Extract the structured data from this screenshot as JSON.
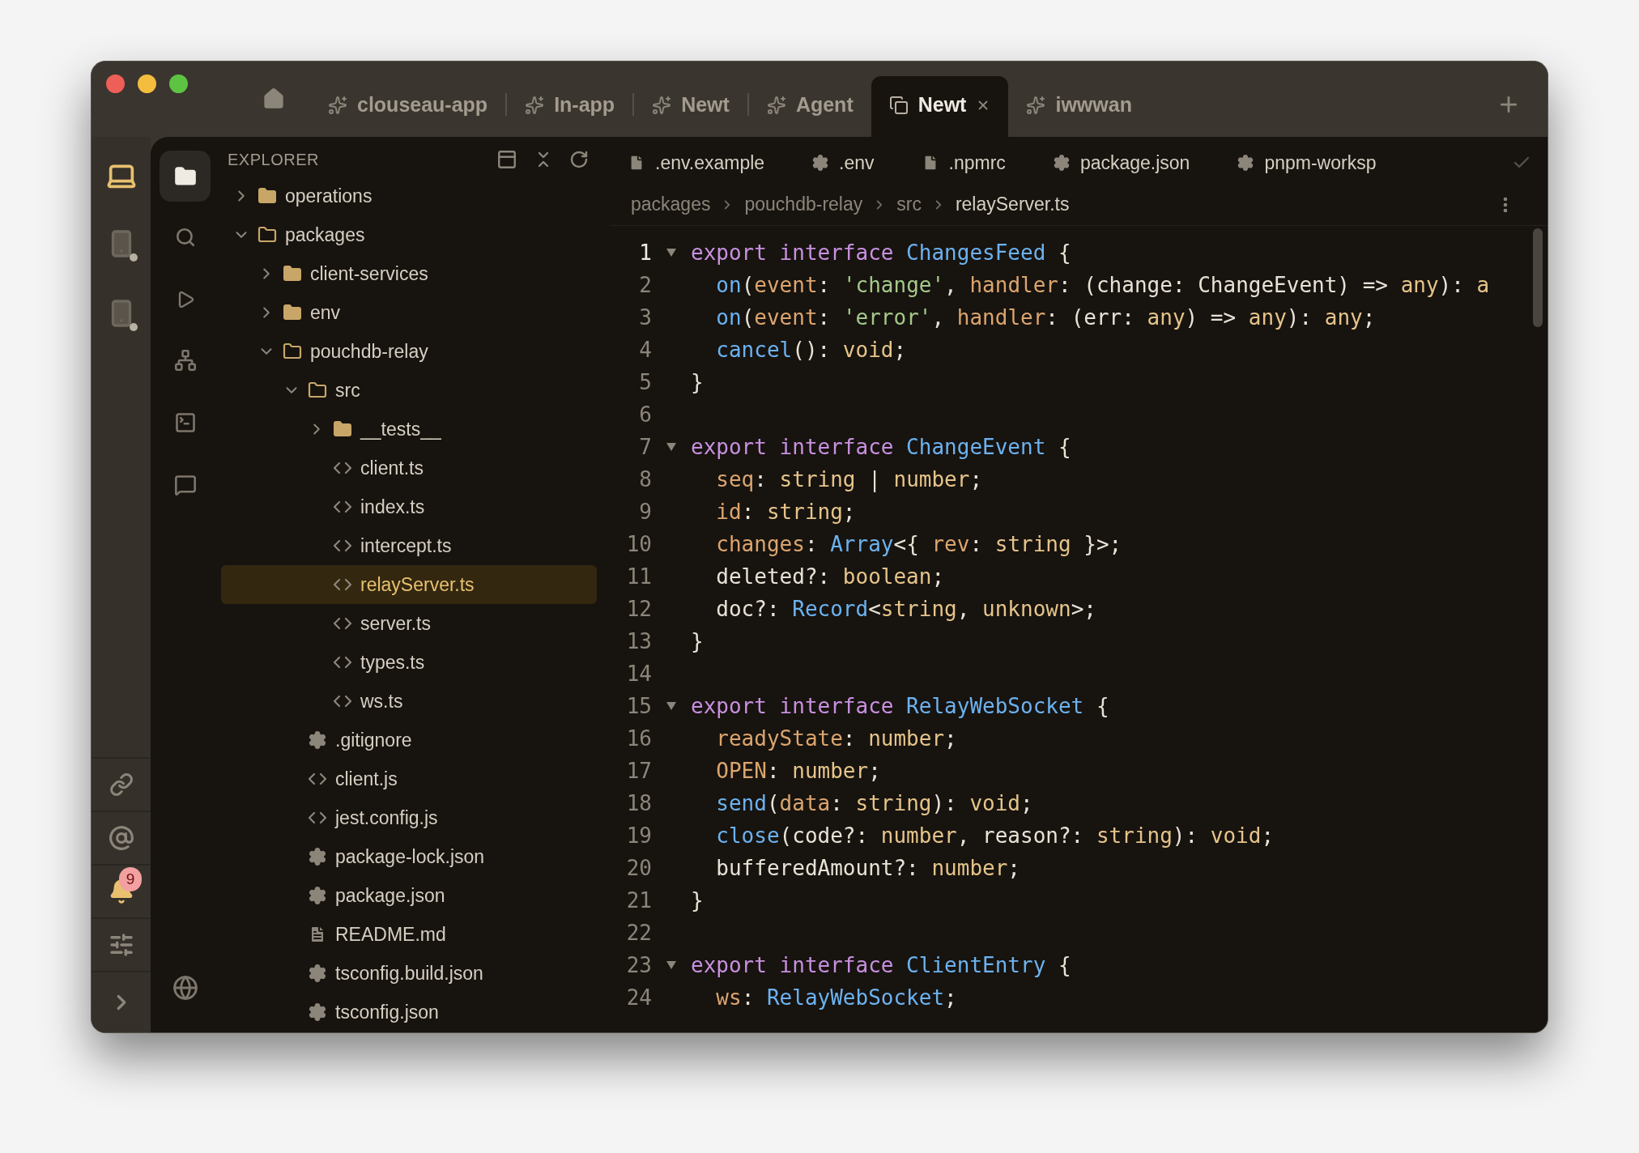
{
  "title_tabs": [
    {
      "label": "clouseau-app",
      "selected": false
    },
    {
      "label": "In-app",
      "selected": false
    },
    {
      "label": "Newt",
      "selected": false
    },
    {
      "label": "Agent",
      "selected": false
    },
    {
      "label": "Newt",
      "selected": true
    },
    {
      "label": "iwwwan",
      "selected": false
    }
  ],
  "device_rail": [
    {
      "selected": true
    },
    {
      "selected": false
    },
    {
      "selected": false
    }
  ],
  "notifications": {
    "count": "9"
  },
  "activity_bar": [
    {
      "selected": true
    },
    {
      "selected": false
    },
    {
      "selected": false
    },
    {
      "selected": false
    },
    {
      "selected": false
    },
    {
      "selected": false
    }
  ],
  "explorer": {
    "title": "EXPLORER",
    "tree": [
      {
        "label": "operations",
        "kind": "folder",
        "expanded": false,
        "selected": false
      },
      {
        "label": "packages",
        "kind": "folder",
        "expanded": true,
        "selected": false,
        "children": [
          {
            "label": "client-services",
            "kind": "folder",
            "expanded": false,
            "selected": false
          },
          {
            "label": "env",
            "kind": "folder",
            "expanded": false,
            "selected": false
          },
          {
            "label": "pouchdb-relay",
            "kind": "folder",
            "expanded": true,
            "selected": false,
            "children": [
              {
                "label": "src",
                "kind": "folder",
                "expanded": true,
                "selected": false,
                "children": [
                  {
                    "label": "__tests__",
                    "kind": "folder",
                    "expanded": false,
                    "selected": false
                  },
                  {
                    "label": "client.ts",
                    "kind": "code",
                    "selected": false
                  },
                  {
                    "label": "index.ts",
                    "kind": "code",
                    "selected": false
                  },
                  {
                    "label": "intercept.ts",
                    "kind": "code",
                    "selected": false
                  },
                  {
                    "label": "relayServer.ts",
                    "kind": "code",
                    "selected": true
                  },
                  {
                    "label": "server.ts",
                    "kind": "code",
                    "selected": false
                  },
                  {
                    "label": "types.ts",
                    "kind": "code",
                    "selected": false
                  },
                  {
                    "label": "ws.ts",
                    "kind": "code",
                    "selected": false
                  }
                ]
              },
              {
                "label": ".gitignore",
                "kind": "config",
                "selected": false
              },
              {
                "label": "client.js",
                "kind": "code",
                "selected": false
              },
              {
                "label": "jest.config.js",
                "kind": "code",
                "selected": false
              },
              {
                "label": "package-lock.json",
                "kind": "config",
                "selected": false
              },
              {
                "label": "package.json",
                "kind": "config",
                "selected": false
              },
              {
                "label": "README.md",
                "kind": "doc",
                "selected": false
              },
              {
                "label": "tsconfig.build.json",
                "kind": "config",
                "selected": false
              },
              {
                "label": "tsconfig.json",
                "kind": "config",
                "selected": false
              }
            ]
          }
        ]
      }
    ]
  },
  "editor_tabs": [
    {
      "label": ".env.example",
      "kind": "file"
    },
    {
      "label": ".env",
      "kind": "config"
    },
    {
      "label": ".npmrc",
      "kind": "file"
    },
    {
      "label": "package.json",
      "kind": "config"
    },
    {
      "label": "pnpm-worksp",
      "kind": "config"
    }
  ],
  "breadcrumbs": [
    "packages",
    "pouchdb-relay",
    "src",
    "relayServer.ts"
  ],
  "code": [
    {
      "number": "1",
      "current": true,
      "fold": true,
      "tokens": [
        {
          "kind": "keyword",
          "text": "export"
        },
        {
          "kind": "keyword",
          "text": " interface"
        },
        {
          "kind": "type",
          "text": " ChangesFeed"
        },
        {
          "kind": "plain",
          "text": " {"
        }
      ]
    },
    {
      "number": "2",
      "current": false,
      "fold": false,
      "tokens": [
        {
          "kind": "func",
          "text": "  on"
        },
        {
          "kind": "plain",
          "text": "("
        },
        {
          "kind": "param",
          "text": "event"
        },
        {
          "kind": "plain",
          "text": ": "
        },
        {
          "kind": "string",
          "text": "'change'"
        },
        {
          "kind": "plain",
          "text": ", "
        },
        {
          "kind": "param",
          "text": "handler"
        },
        {
          "kind": "plain",
          "text": ": (change: ChangeEvent) => "
        },
        {
          "kind": "prim",
          "text": "any"
        },
        {
          "kind": "plain",
          "text": "): "
        },
        {
          "kind": "prim",
          "text": "a"
        }
      ]
    },
    {
      "number": "3",
      "current": false,
      "fold": false,
      "tokens": [
        {
          "kind": "func",
          "text": "  on"
        },
        {
          "kind": "plain",
          "text": "("
        },
        {
          "kind": "param",
          "text": "event"
        },
        {
          "kind": "plain",
          "text": ": "
        },
        {
          "kind": "string",
          "text": "'error'"
        },
        {
          "kind": "plain",
          "text": ", "
        },
        {
          "kind": "param",
          "text": "handler"
        },
        {
          "kind": "plain",
          "text": ": (err: "
        },
        {
          "kind": "prim",
          "text": "any"
        },
        {
          "kind": "plain",
          "text": ") => "
        },
        {
          "kind": "prim",
          "text": "any"
        },
        {
          "kind": "plain",
          "text": "): "
        },
        {
          "kind": "prim",
          "text": "any"
        },
        {
          "kind": "plain",
          "text": ";"
        }
      ]
    },
    {
      "number": "4",
      "current": false,
      "fold": false,
      "tokens": [
        {
          "kind": "func",
          "text": "  cancel"
        },
        {
          "kind": "plain",
          "text": "(): "
        },
        {
          "kind": "prim",
          "text": "void"
        },
        {
          "kind": "plain",
          "text": ";"
        }
      ]
    },
    {
      "number": "5",
      "current": false,
      "fold": false,
      "tokens": [
        {
          "kind": "plain",
          "text": "}"
        }
      ]
    },
    {
      "number": "6",
      "current": false,
      "fold": false
    },
    {
      "number": "7",
      "current": false,
      "fold": true,
      "tokens": [
        {
          "kind": "keyword",
          "text": "export"
        },
        {
          "kind": "keyword",
          "text": " interface"
        },
        {
          "kind": "type",
          "text": " ChangeEvent"
        },
        {
          "kind": "plain",
          "text": " {"
        }
      ]
    },
    {
      "number": "8",
      "current": false,
      "fold": false,
      "tokens": [
        {
          "kind": "param",
          "text": "  seq"
        },
        {
          "kind": "plain",
          "text": ": "
        },
        {
          "kind": "prim",
          "text": "string"
        },
        {
          "kind": "plain",
          "text": " | "
        },
        {
          "kind": "prim",
          "text": "number"
        },
        {
          "kind": "plain",
          "text": ";"
        }
      ]
    },
    {
      "number": "9",
      "current": false,
      "fold": false,
      "tokens": [
        {
          "kind": "param",
          "text": "  id"
        },
        {
          "kind": "plain",
          "text": ": "
        },
        {
          "kind": "prim",
          "text": "string"
        },
        {
          "kind": "plain",
          "text": ";"
        }
      ]
    },
    {
      "number": "10",
      "current": false,
      "fold": false,
      "tokens": [
        {
          "kind": "param",
          "text": "  changes"
        },
        {
          "kind": "plain",
          "text": ": "
        },
        {
          "kind": "type",
          "text": "Array"
        },
        {
          "kind": "plain",
          "text": "<{ "
        },
        {
          "kind": "param",
          "text": "rev"
        },
        {
          "kind": "plain",
          "text": ": "
        },
        {
          "kind": "prim",
          "text": "string"
        },
        {
          "kind": "plain",
          "text": " }>;"
        }
      ]
    },
    {
      "number": "11",
      "current": false,
      "fold": false,
      "tokens": [
        {
          "kind": "plain",
          "text": "  deleted?: "
        },
        {
          "kind": "prim",
          "text": "boolean"
        },
        {
          "kind": "plain",
          "text": ";"
        }
      ]
    },
    {
      "number": "12",
      "current": false,
      "fold": false,
      "tokens": [
        {
          "kind": "plain",
          "text": "  doc?: "
        },
        {
          "kind": "type",
          "text": "Record"
        },
        {
          "kind": "plain",
          "text": "<"
        },
        {
          "kind": "prim",
          "text": "string"
        },
        {
          "kind": "plain",
          "text": ", "
        },
        {
          "kind": "prim",
          "text": "unknown"
        },
        {
          "kind": "plain",
          "text": ">;"
        }
      ]
    },
    {
      "number": "13",
      "current": false,
      "fold": false,
      "tokens": [
        {
          "kind": "plain",
          "text": "}"
        }
      ]
    },
    {
      "number": "14",
      "current": false,
      "fold": false
    },
    {
      "number": "15",
      "current": false,
      "fold": true,
      "tokens": [
        {
          "kind": "keyword",
          "text": "export"
        },
        {
          "kind": "keyword",
          "text": " interface"
        },
        {
          "kind": "type",
          "text": " RelayWebSocket"
        },
        {
          "kind": "plain",
          "text": " {"
        }
      ]
    },
    {
      "number": "16",
      "current": false,
      "fold": false,
      "tokens": [
        {
          "kind": "param",
          "text": "  readyState"
        },
        {
          "kind": "plain",
          "text": ": "
        },
        {
          "kind": "prim",
          "text": "number"
        },
        {
          "kind": "plain",
          "text": ";"
        }
      ]
    },
    {
      "number": "17",
      "current": false,
      "fold": false,
      "tokens": [
        {
          "kind": "param",
          "text": "  OPEN"
        },
        {
          "kind": "plain",
          "text": ": "
        },
        {
          "kind": "prim",
          "text": "number"
        },
        {
          "kind": "plain",
          "text": ";"
        }
      ]
    },
    {
      "number": "18",
      "current": false,
      "fold": false,
      "tokens": [
        {
          "kind": "func",
          "text": "  send"
        },
        {
          "kind": "plain",
          "text": "("
        },
        {
          "kind": "param",
          "text": "data"
        },
        {
          "kind": "plain",
          "text": ": "
        },
        {
          "kind": "prim",
          "text": "string"
        },
        {
          "kind": "plain",
          "text": "): "
        },
        {
          "kind": "prim",
          "text": "void"
        },
        {
          "kind": "plain",
          "text": ";"
        }
      ]
    },
    {
      "number": "19",
      "current": false,
      "fold": false,
      "tokens": [
        {
          "kind": "func",
          "text": "  close"
        },
        {
          "kind": "plain",
          "text": "(code?: "
        },
        {
          "kind": "prim",
          "text": "number"
        },
        {
          "kind": "plain",
          "text": ", reason?: "
        },
        {
          "kind": "prim",
          "text": "string"
        },
        {
          "kind": "plain",
          "text": "): "
        },
        {
          "kind": "prim",
          "text": "void"
        },
        {
          "kind": "plain",
          "text": ";"
        }
      ]
    },
    {
      "number": "20",
      "current": false,
      "fold": false,
      "tokens": [
        {
          "kind": "plain",
          "text": "  bufferedAmount?: "
        },
        {
          "kind": "prim",
          "text": "number"
        },
        {
          "kind": "plain",
          "text": ";"
        }
      ]
    },
    {
      "number": "21",
      "current": false,
      "fold": false,
      "tokens": [
        {
          "kind": "plain",
          "text": "}"
        }
      ]
    },
    {
      "number": "22",
      "current": false,
      "fold": false
    },
    {
      "number": "23",
      "current": false,
      "fold": true,
      "tokens": [
        {
          "kind": "keyword",
          "text": "export"
        },
        {
          "kind": "keyword",
          "text": " interface"
        },
        {
          "kind": "type",
          "text": " ClientEntry"
        },
        {
          "kind": "plain",
          "text": " {"
        }
      ]
    },
    {
      "number": "24",
      "current": false,
      "fold": false,
      "tokens": [
        {
          "kind": "param",
          "text": "  ws"
        },
        {
          "kind": "plain",
          "text": ": "
        },
        {
          "kind": "type",
          "text": "RelayWebSocket"
        },
        {
          "kind": "plain",
          "text": ";"
        }
      ]
    }
  ]
}
